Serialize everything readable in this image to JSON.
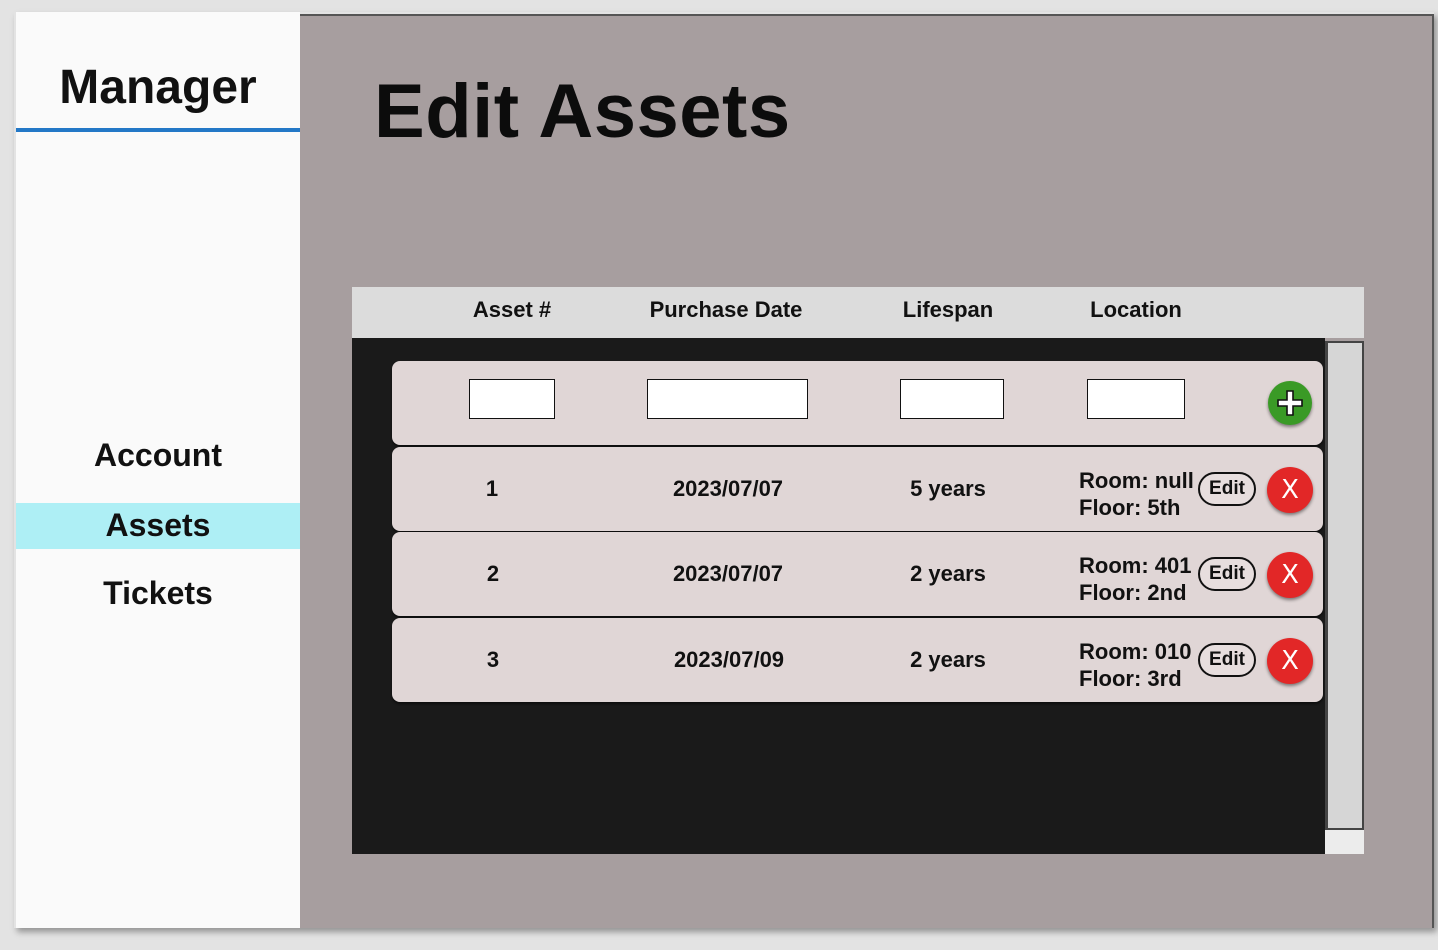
{
  "sidebar": {
    "brand": "Manager",
    "items": [
      {
        "label": "Account"
      },
      {
        "label": "Assets"
      },
      {
        "label": "Tickets"
      }
    ],
    "active_item": "Assets"
  },
  "main": {
    "title": "Edit Assets"
  },
  "table": {
    "headers": [
      "Asset #",
      "Purchase Date",
      "Lifespan",
      "Location"
    ],
    "new_row": {
      "asset": "",
      "purchase_date": "",
      "lifespan": "",
      "location": ""
    },
    "rows": [
      {
        "asset": "1",
        "purchase_date": "2023/07/07",
        "lifespan": "5 years",
        "room": "Room: null",
        "floor": "Floor: 5th",
        "edit_label": "Edit",
        "delete_label": "X"
      },
      {
        "asset": "2",
        "purchase_date": "2023/07/07",
        "lifespan": "2 years",
        "room": "Room: 401",
        "floor": "Floor: 2nd",
        "edit_label": "Edit",
        "delete_label": "X"
      },
      {
        "asset": "3",
        "purchase_date": "2023/07/09",
        "lifespan": "2 years",
        "room": "Room: 010",
        "floor": "Floor: 3rd",
        "edit_label": "Edit",
        "delete_label": "X"
      }
    ]
  },
  "icons": {
    "add": "plus-icon",
    "delete": "close-icon"
  },
  "colors": {
    "accent_rule": "#2378c7",
    "active_nav": "#aeeff5",
    "add_button": "#3a9a26",
    "delete_button": "#e22727",
    "main_background": "#a79e9f"
  }
}
